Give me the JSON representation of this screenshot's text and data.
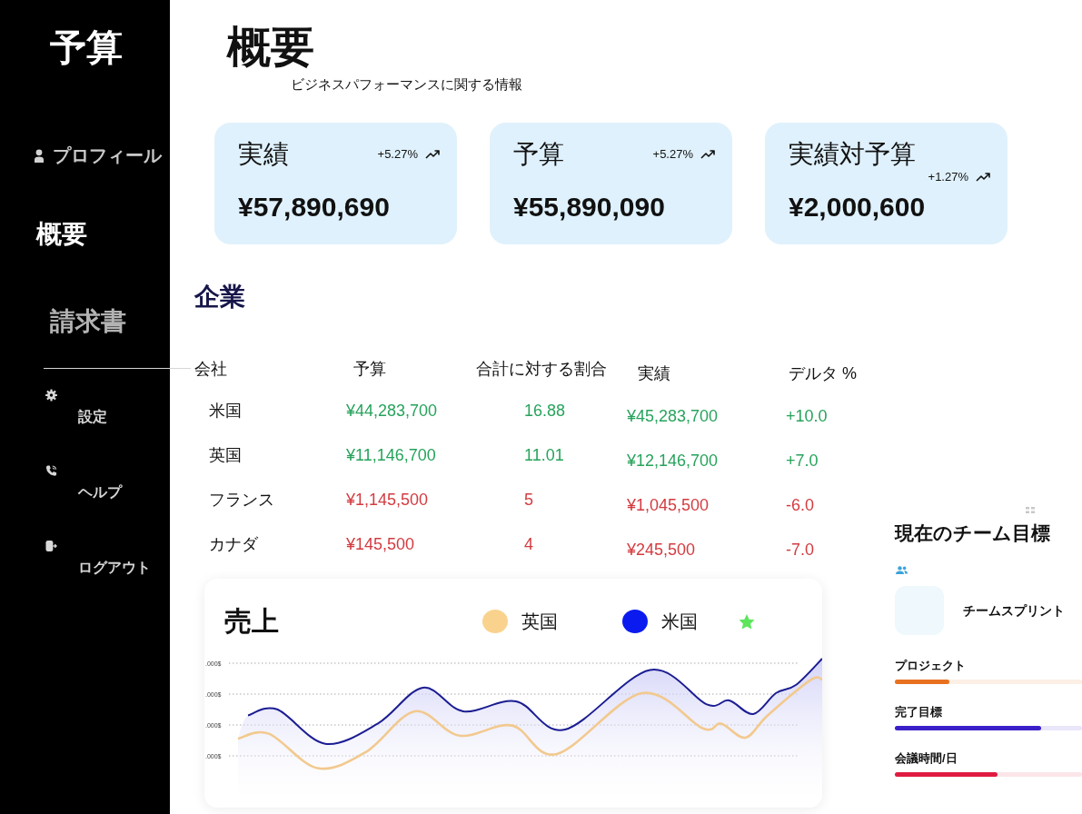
{
  "sidebar": {
    "title": "予算",
    "profile": {
      "label": "プロフィール"
    },
    "nav": [
      {
        "label": "概要",
        "selected": true
      },
      {
        "label": "請求書",
        "selected": false
      }
    ],
    "actions": [
      {
        "label": "設定"
      },
      {
        "label": "ヘルプ"
      },
      {
        "label": "ログアウト"
      }
    ]
  },
  "header": {
    "title": "概要",
    "subtitle": "ビジネスパフォーマンスに関する情報"
  },
  "kpi_cards": [
    {
      "title": "実績",
      "change": "+5.27%",
      "value": "¥57,890,690"
    },
    {
      "title": "予算",
      "change": "+5.27%",
      "value": "¥55,890,090"
    },
    {
      "title": "実績対予算",
      "change": "+1.27%",
      "value": "¥2,000,600"
    }
  ],
  "companies": {
    "title": "企業",
    "columns": [
      "会社",
      "予算",
      "合計に対する割合",
      "実績",
      "デルタ %"
    ],
    "rows": [
      {
        "cells": [
          "米国",
          "¥44,283,700",
          "16.88",
          "¥45,283,700",
          "+10.0"
        ],
        "color": "#27a35c"
      },
      {
        "cells": [
          "英国",
          "¥11,146,700",
          "11.01",
          "¥12,146,700",
          "+7.0"
        ],
        "color": "#27a35c"
      },
      {
        "cells": [
          "フランス",
          "¥1,145,500",
          "5",
          "¥1,045,500",
          "-6.0"
        ],
        "color": "#d33b40"
      },
      {
        "cells": [
          "カナダ",
          "¥145,500",
          "4",
          "¥245,500",
          "-7.0"
        ],
        "color": "#d33b40"
      }
    ]
  },
  "sales": {
    "title": "売上",
    "legend": [
      {
        "kind": "dot",
        "label": "英国",
        "color": "#f9d38e"
      },
      {
        "kind": "dot",
        "label": "米国",
        "color": "#0b1bef"
      },
      {
        "kind": "star",
        "color": "#5ce65c"
      }
    ],
    "y_tick_labels": [
      ".000$",
      ".000$",
      ".000$",
      ".000$"
    ]
  },
  "team_goals": {
    "title": "現在のチーム目標",
    "team": "チームスプリント",
    "goals": [
      {
        "label": "プロジェクト",
        "level": 0.29,
        "color": "#e8711f"
      },
      {
        "label": "完了目標",
        "level": 0.78,
        "color": "#3b1fc9"
      },
      {
        "label": "会議時間/日",
        "level": 0.55,
        "color": "#e01b41"
      }
    ]
  }
}
